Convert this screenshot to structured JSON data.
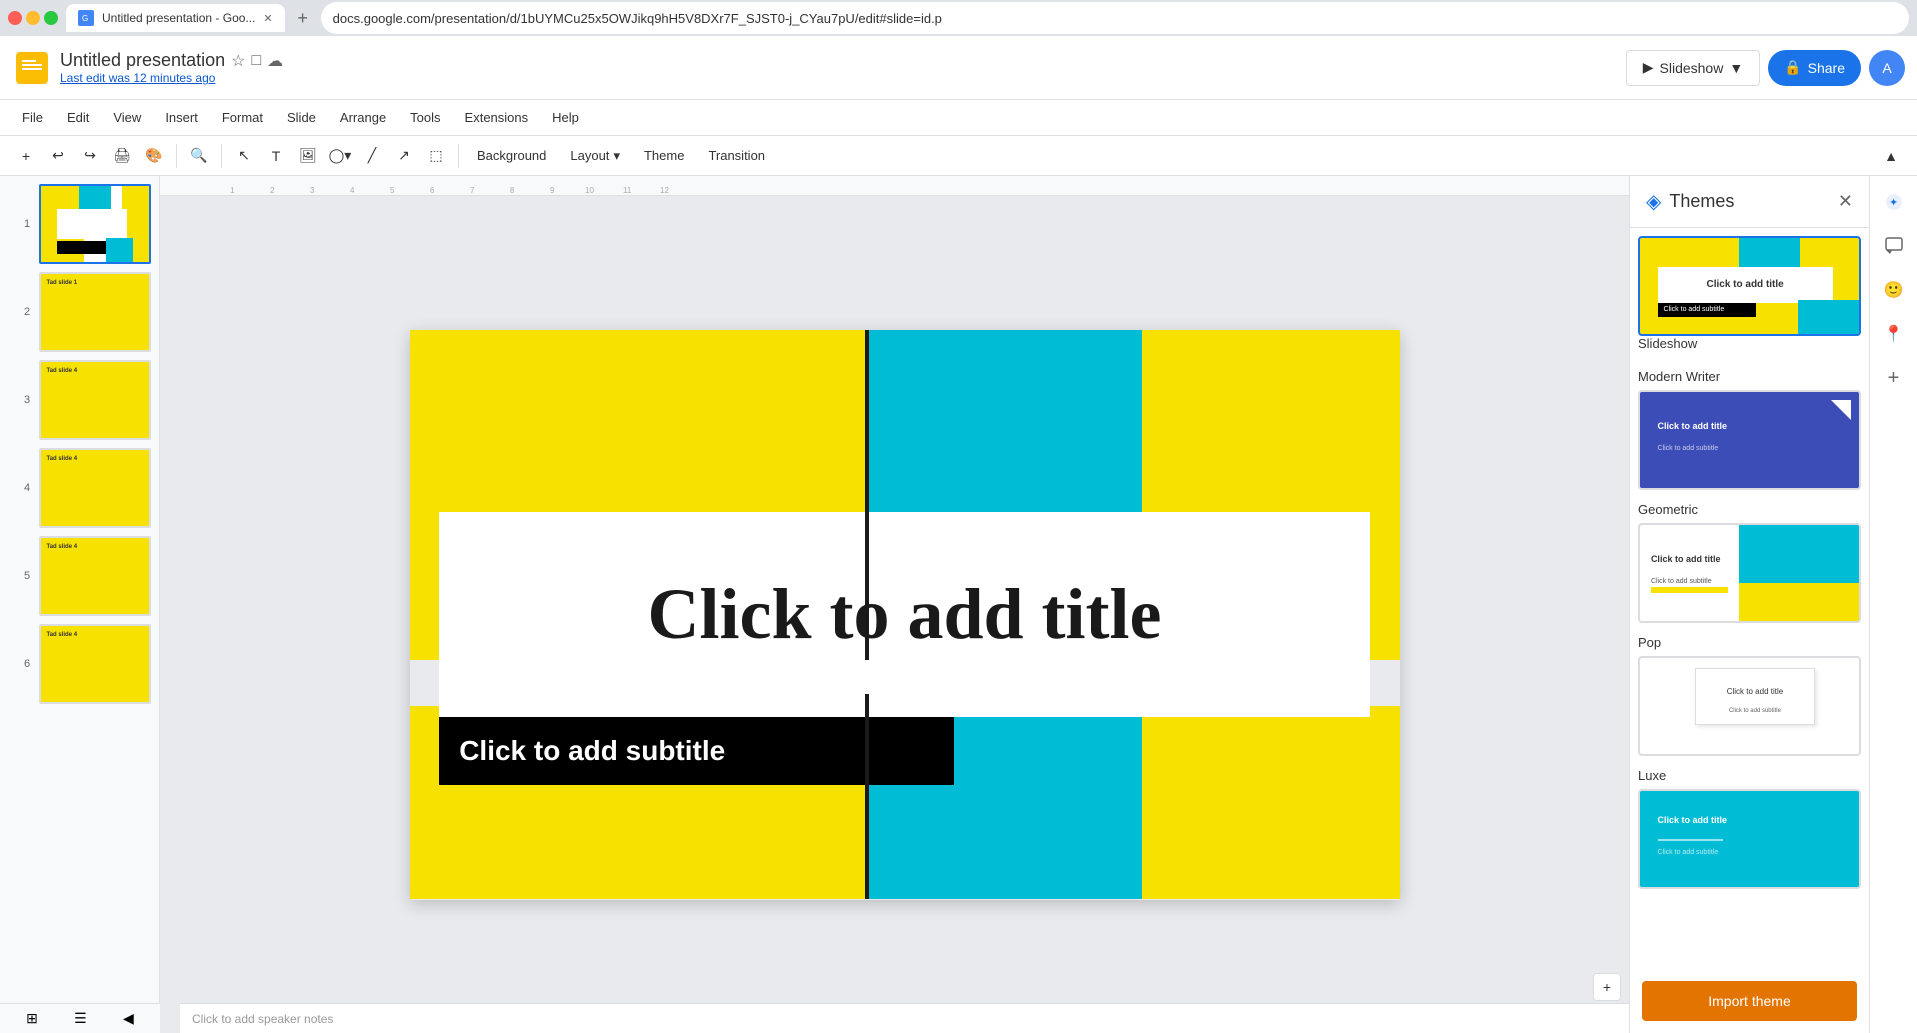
{
  "browser": {
    "tab_title": "Untitled presentation - Goo...",
    "url": "docs.google.com/presentation/d/1bUYMCu25x5OWJikq9hH5V8DXr7F_SJST0-j_CYau7pU/edit#slide=id.p",
    "new_tab_icon": "+"
  },
  "header": {
    "app_title": "Untitled presentation",
    "last_edit": "Last edit was 12 minutes ago",
    "slideshow_label": "Slideshow",
    "share_label": "Share"
  },
  "menu": {
    "items": [
      "File",
      "Edit",
      "View",
      "Insert",
      "Format",
      "Slide",
      "Arrange",
      "Tools",
      "Extensions",
      "Help"
    ]
  },
  "toolbar": {
    "background_label": "Background",
    "layout_label": "Layout",
    "theme_label": "Theme",
    "transition_label": "Transition"
  },
  "slide": {
    "title_placeholder": "Click to add title",
    "subtitle_placeholder": "Click to add subtitle",
    "notes_placeholder": "Click to add speaker notes"
  },
  "slides_panel": {
    "thumbnails": [
      {
        "number": "1",
        "active": true
      },
      {
        "number": "2",
        "active": false
      },
      {
        "number": "3",
        "active": false
      },
      {
        "number": "4",
        "active": false
      },
      {
        "number": "5",
        "active": false
      },
      {
        "number": "6",
        "active": false
      }
    ]
  },
  "themes_panel": {
    "title": "Themes",
    "themes": [
      {
        "name": "Slideshow",
        "selected": true,
        "preview_type": "slideshow"
      },
      {
        "name": "Modern Writer",
        "selected": false,
        "preview_type": "modern_writer"
      },
      {
        "name": "Geometric",
        "selected": false,
        "preview_type": "geometric"
      },
      {
        "name": "Pop",
        "selected": false,
        "preview_type": "pop"
      },
      {
        "name": "Luxe",
        "selected": false,
        "preview_type": "luxe"
      }
    ],
    "import_theme_label": "Import theme",
    "close_icon": "✕"
  },
  "colors": {
    "yellow": "#f7e100",
    "cyan": "#00bcd4",
    "black": "#000000",
    "white": "#ffffff",
    "accent_blue": "#1a73e8"
  }
}
